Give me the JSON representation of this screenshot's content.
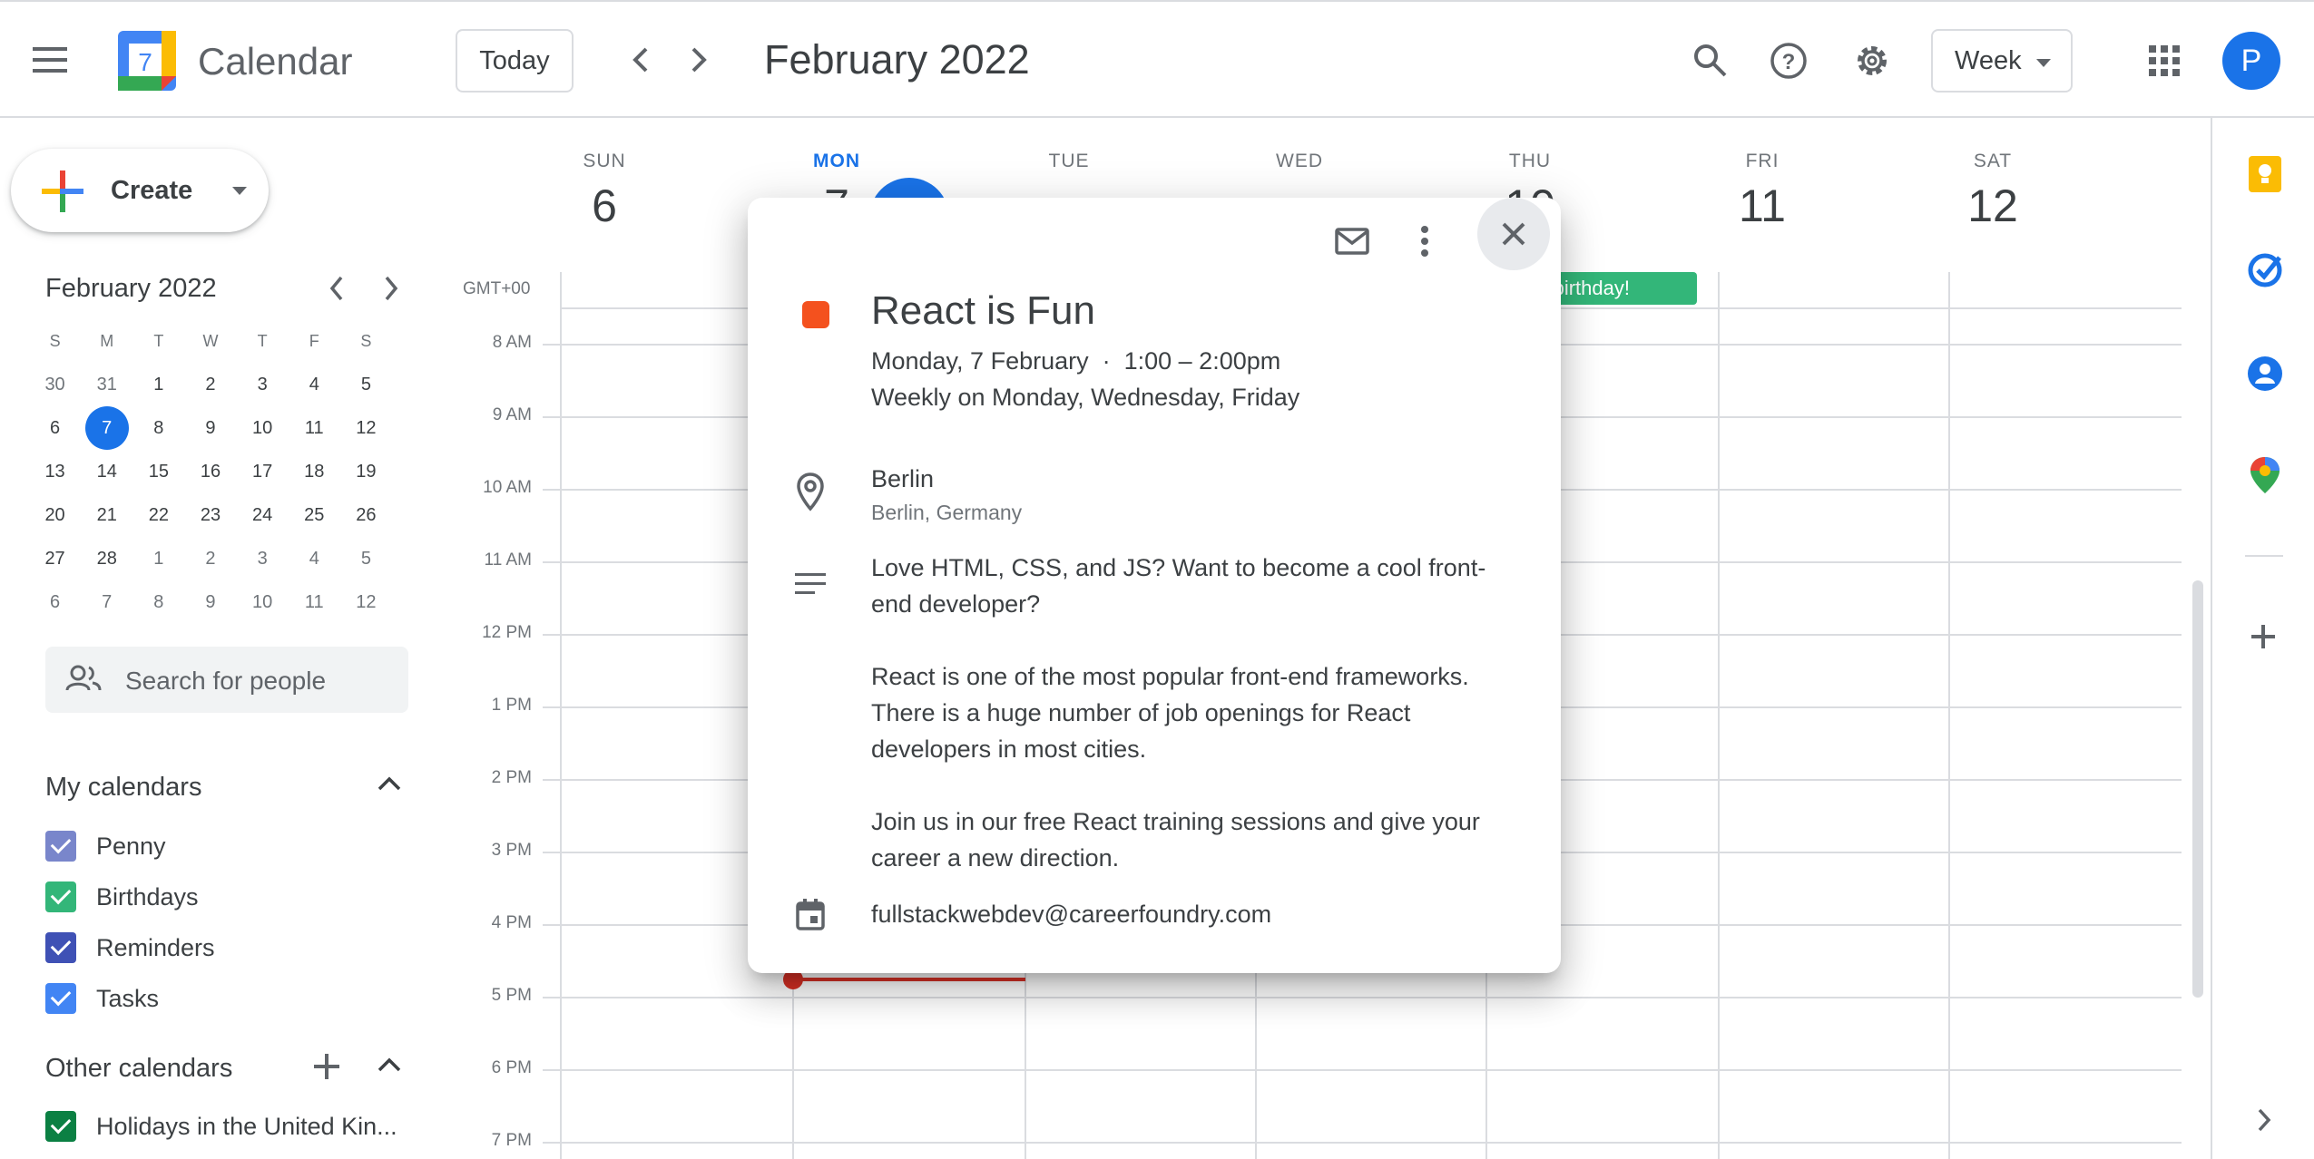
{
  "header": {
    "app_name": "Calendar",
    "logo_day": "7",
    "today_label": "Today",
    "month_title": "February 2022",
    "view_label": "Week",
    "avatar_initial": "P"
  },
  "sidebar": {
    "create_label": "Create",
    "mini_calendar": {
      "title": "February 2022",
      "weekdays": [
        "S",
        "M",
        "T",
        "W",
        "T",
        "F",
        "S"
      ],
      "weeks": [
        [
          "30",
          "31",
          "1",
          "2",
          "3",
          "4",
          "5"
        ],
        [
          "6",
          "7",
          "8",
          "9",
          "10",
          "11",
          "12"
        ],
        [
          "13",
          "14",
          "15",
          "16",
          "17",
          "18",
          "19"
        ],
        [
          "20",
          "21",
          "22",
          "23",
          "24",
          "25",
          "26"
        ],
        [
          "27",
          "28",
          "1",
          "2",
          "3",
          "4",
          "5"
        ],
        [
          "6",
          "7",
          "8",
          "9",
          "10",
          "11",
          "12"
        ]
      ],
      "selected": "7"
    },
    "search_placeholder": "Search for people",
    "my_calendars_title": "My calendars",
    "my_calendars": [
      {
        "label": "Penny",
        "color": "#7986cb"
      },
      {
        "label": "Birthdays",
        "color": "#33b679"
      },
      {
        "label": "Reminders",
        "color": "#3f51b5"
      },
      {
        "label": "Tasks",
        "color": "#4285f4"
      }
    ],
    "other_calendars_title": "Other calendars",
    "other_calendars": [
      {
        "label": "Holidays in the United Kin...",
        "color": "#0b8043"
      }
    ]
  },
  "week": {
    "days": [
      {
        "name": "SUN",
        "num": "6"
      },
      {
        "name": "MON",
        "num": "7"
      },
      {
        "name": "TUE",
        "num": ""
      },
      {
        "name": "WED",
        "num": ""
      },
      {
        "name": "THU",
        "num": "10"
      },
      {
        "name": "FRI",
        "num": "11"
      },
      {
        "name": "SAT",
        "num": "12"
      }
    ],
    "timezone": "GMT+00",
    "hours": [
      "8 AM",
      "9 AM",
      "10 AM",
      "11 AM",
      "12 PM",
      "1 PM",
      "2 PM",
      "3 PM",
      "4 PM",
      "5 PM",
      "6 PM",
      "7 PM"
    ],
    "all_day_event": "ppy birthday!"
  },
  "event_popup": {
    "title": "React is Fun",
    "color": "#f4511e",
    "date_time": "Monday, 7 February  ·  1:00 – 2:00pm",
    "recurrence": "Weekly on Monday, Wednesday, Friday",
    "location": "Berlin",
    "location_detail": "Berlin, Germany",
    "description": [
      "Love HTML, CSS, and JS? Want to become a cool front-end developer?",
      "React is one of the most popular front-end frameworks. There is a huge number of job openings for React developers in most cities.",
      "Join us in our free React training sessions and give your career a new direction."
    ],
    "calendar": "fullstackwebdev@careerfoundry.com"
  }
}
